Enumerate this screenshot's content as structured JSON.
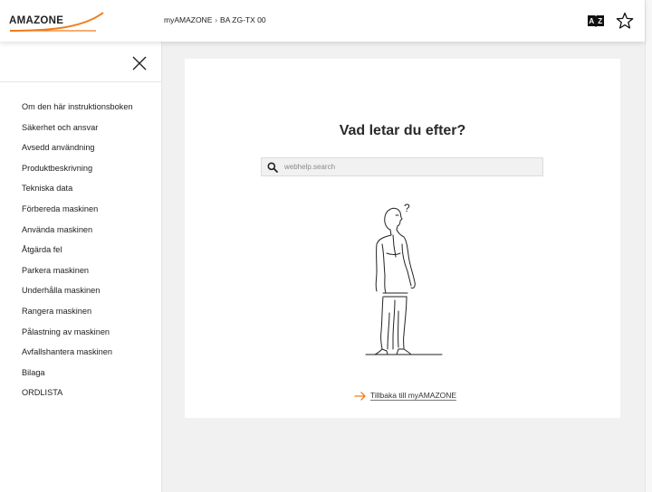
{
  "brand": {
    "logo_text": "AMAZONE",
    "accent_color": "#ef7d1a"
  },
  "header": {
    "breadcrumb": [
      "myAMAZONE",
      "BA ZG-TX 00"
    ],
    "breadcrumb_separator": "›",
    "icons": [
      "dictionary-icon",
      "favorite-star-icon"
    ]
  },
  "sidebar": {
    "close_icon": "close-icon",
    "items": [
      "Om den här instruktionsboken",
      "Säkerhet och ansvar",
      "Avsedd användning",
      "Produktbeskrivning",
      "Tekniska data",
      "Förbereda maskinen",
      "Använda maskinen",
      "Åtgärda fel",
      "Parkera maskinen",
      "Underhålla maskinen",
      "Rangera maskinen",
      "Pålastning av maskinen",
      "Avfallshantera maskinen",
      "Bilaga",
      "ORDLISTA"
    ]
  },
  "main": {
    "title": "Vad letar du efter?",
    "search": {
      "placeholder": "webhelp.search",
      "value": ""
    },
    "back_link": "Tillbaka till myAMAZONE",
    "illustration_text": "?"
  }
}
